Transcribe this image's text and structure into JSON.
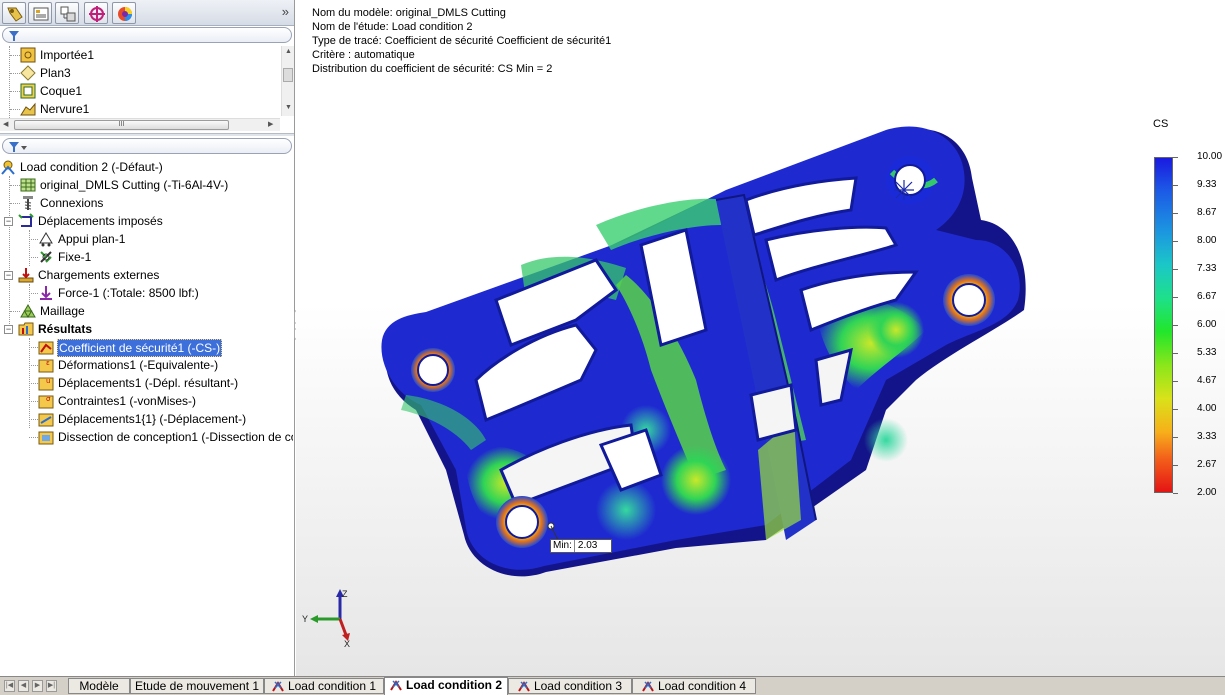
{
  "feature_tree": {
    "items": [
      {
        "label": "Importée1",
        "icon": "imported-part-icon"
      },
      {
        "label": "Plan3",
        "icon": "plane-icon"
      },
      {
        "label": "Coque1",
        "icon": "shell-feature-icon"
      },
      {
        "label": "Nervure1",
        "icon": "rib-feature-icon"
      }
    ],
    "scroll_grip": "III"
  },
  "study_tree": {
    "items": [
      {
        "label": "Load condition 2 (-Défaut-)",
        "icon": "study-icon"
      },
      {
        "label": "original_DMLS Cutting (-Ti-6Al-4V-)",
        "icon": "part-material-icon"
      },
      {
        "label": "Connexions",
        "icon": "connections-icon"
      },
      {
        "label": "Déplacements imposés",
        "icon": "fixtures-icon"
      },
      {
        "label": "Appui plan-1",
        "icon": "roller-fixture-icon"
      },
      {
        "label": "Fixe-1",
        "icon": "fixed-fixture-icon"
      },
      {
        "label": "Chargements externes",
        "icon": "external-loads-icon"
      },
      {
        "label": "Force-1 (:Totale: 8500 lbf:)",
        "icon": "force-icon"
      },
      {
        "label": "Maillage",
        "icon": "mesh-icon"
      },
      {
        "label": "Résultats",
        "icon": "results-folder-icon"
      },
      {
        "label": "Coefficient de sécurité1 (-CS-)",
        "icon": "factor-of-safety-plot-icon"
      },
      {
        "label": "Déformations1 (-Equivalente-)",
        "icon": "strain-plot-icon"
      },
      {
        "label": "Déplacements1 (-Dépl. résultant-)",
        "icon": "displacement-plot-icon"
      },
      {
        "label": "Contraintes1 (-vonMises-)",
        "icon": "stress-plot-icon"
      },
      {
        "label": "Déplacements1{1} (-Déplacement-)",
        "icon": "displacement-plot-icon"
      },
      {
        "label": "Dissection de conception1 (-Dissection de co",
        "icon": "design-insight-plot-icon"
      }
    ]
  },
  "plot_info": {
    "lines": [
      "Nom du modèle: original_DMLS Cutting",
      "Nom de l'étude: Load condition 2",
      "Type de tracé: Coefficient de sécurité Coefficient de sécurité1",
      "Critère : automatique",
      "Distribution du coefficient de sécurité: CS Min = 2"
    ]
  },
  "legend": {
    "title": "CS",
    "ticks": [
      "10.00",
      "9.33",
      "8.67",
      "8.00",
      "7.33",
      "6.67",
      "6.00",
      "5.33",
      "4.67",
      "4.00",
      "3.33",
      "2.67",
      "2.00"
    ],
    "colors": {
      "high": "#1a1ae0",
      "mid": "#22e62a",
      "low": "#e51414"
    }
  },
  "min_marker": {
    "label": "Min:",
    "value": "2.03"
  },
  "triad": {
    "x": "X",
    "y": "Y",
    "z": "Z"
  },
  "bottom_tabs": [
    {
      "label": "Modèle",
      "active": false,
      "sim_icon": false
    },
    {
      "label": "Etude de mouvement 1",
      "active": false,
      "sim_icon": false
    },
    {
      "label": "Load condition 1",
      "active": false,
      "sim_icon": true
    },
    {
      "label": "Load condition 2",
      "active": true,
      "sim_icon": true
    },
    {
      "label": "Load condition 3",
      "active": false,
      "sim_icon": true
    },
    {
      "label": "Load condition 4",
      "active": false,
      "sim_icon": true
    }
  ]
}
